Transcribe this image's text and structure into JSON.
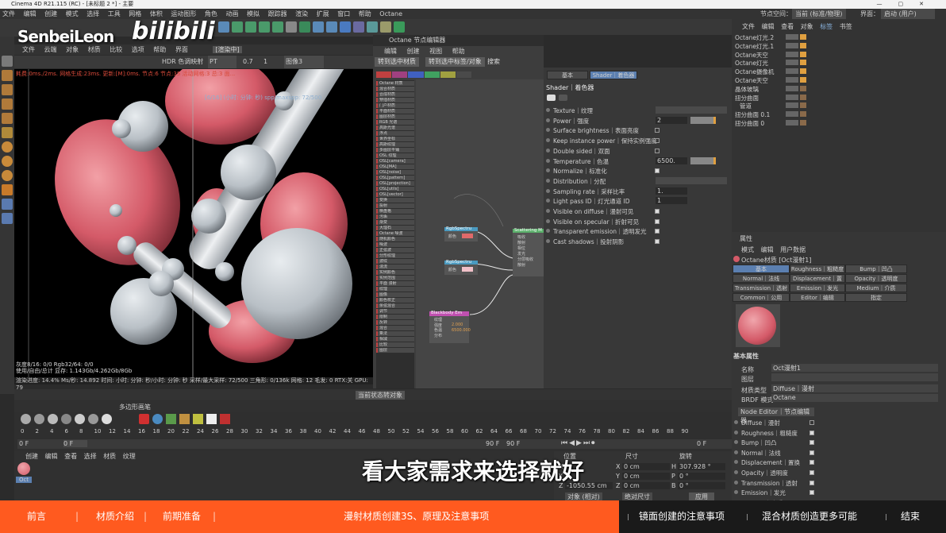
{
  "window": {
    "title": "Cinema 4D R21.115 (RC) - [未标题 2 *] - 主要"
  },
  "menu": [
    "文件",
    "编辑",
    "创建",
    "模式",
    "选择",
    "工具",
    "网格",
    "体积",
    "运动图形",
    "角色",
    "动画",
    "模拟",
    "跟踪器",
    "渲染",
    "扩展",
    "窗口",
    "帮助",
    "Octane"
  ],
  "menu_right": {
    "node_space_label": "节点空间：",
    "node_space_value": "当前 (标准/物理)",
    "layout_label": "界面：",
    "layout_value": "启动 (用户)"
  },
  "watermark": {
    "author": "SenbeiLeon",
    "site": "bilibili"
  },
  "viewport": {
    "menu": [
      "文件",
      "云端",
      "对象",
      "材质",
      "比较",
      "选项",
      "帮助",
      "界面"
    ],
    "title": "[渲染中]",
    "toolbar": {
      "hdr": "HDR 色调映射",
      "pt": "PT",
      "value": "0.7",
      "count": "1",
      "mode": "图像3"
    },
    "status": "耗费:0ms./2ms. 网格生成:23ms. 更新:[M]:0ms. 节点:6 节点:35 活动网格:3 总:3 面...",
    "overlay": "[6/16] (小时: 分钟: 秒) spp/maxspp: 72/500",
    "info1": "灰度8/16: 0/0          Rgb32/64: 0/0",
    "info2": "使用/自由/总计 显存: 1.143Gb/4.262Gb/8Gb",
    "info3": "渲染进度: 14.4%  Ms/秒: 14.892   时间: 小时: 分钟: 秒/小时: 分钟: 秒   采样/最大采样: 72/500   三角形: 0/136k   网格: 12   毛发: 0   RTX:关   GPU: 79"
  },
  "node_editor": {
    "header": "Octane 节点编辑器",
    "menu": [
      "编辑",
      "创建",
      "视图",
      "帮助"
    ],
    "buttons": [
      "转到选中材质",
      "转到选中标签/对象",
      "搜索"
    ],
    "nodes": [
      {
        "name": "RgbSpectru",
        "port": "颜色"
      },
      {
        "name": "RgbSpectru",
        "port": "颜色"
      },
      {
        "name": "Scattering M",
        "ports": [
          "吸收",
          "散射",
          "相位",
          "发光",
          "分层吸收",
          "散射"
        ]
      },
      {
        "name": "Blackbody Em",
        "ports": [
          "纹理",
          "强度",
          "色温",
          "分布"
        ],
        "values": [
          "",
          "2.000",
          "6500.000",
          ""
        ]
      }
    ],
    "palette": [
      "Octane 材质",
      "混合材质",
      "合成材质",
      "穿插材质",
      "门户材质",
      "平面材质",
      "图层材质",
      "RGB 光谱",
      "高斯光谱",
      "浮点",
      "世界坐标",
      "高斯纹理",
      "多图层平铺",
      "OSL 纹理",
      "OSL[camera]",
      "OSL[MA]",
      "OSL[noise]",
      "OSL[pattern]",
      "OSL[projection]",
      "OSL[utils]",
      "OSL[vector]",
      "变换",
      "投射",
      "棋盘格",
      "污垢",
      "渐变",
      "大理石",
      "Octane 噪波",
      "随机颜色",
      "噪波",
      "正弦波",
      "分形纹理",
      "波纹",
      "湍流",
      "实例颜色",
      "实例范围",
      "平面 漫射",
      "纹理",
      "图像",
      "颜色校正",
      "余弦混合",
      "调节",
      "限制",
      "反转",
      "混合",
      "乘法",
      "相减",
      "比较",
      "图层"
    ]
  },
  "shader": {
    "tabs": [
      "基本",
      "Shader｜着色器"
    ],
    "heading": "Shader｜着色器",
    "rows": [
      {
        "label": "Texture｜纹理",
        "type": "link"
      },
      {
        "label": "Power｜强度",
        "value": "2"
      },
      {
        "label": "Surface brightness｜表面亮度",
        "checked": false
      },
      {
        "label": "Keep instance power｜保持实例强度",
        "checked": false
      },
      {
        "label": "Double sided｜双面",
        "checked": false
      },
      {
        "label": "Temperature｜色温",
        "value": "6500."
      },
      {
        "label": "Normalize｜标准化",
        "checked": true
      },
      {
        "label": "Distribution｜分配",
        "type": "link"
      },
      {
        "label": "Sampling rate｜采样比率",
        "value": "1."
      },
      {
        "label": "Light pass ID｜灯光通道 ID",
        "value": "1"
      },
      {
        "label": "Visible on diffuse｜漫射可见",
        "checked": true
      },
      {
        "label": "Visible on specular｜折射可见",
        "checked": true
      },
      {
        "label": "Transparent emission｜透明发光",
        "checked": true
      },
      {
        "label": "Cast shadows｜投射阴影",
        "checked": true
      }
    ]
  },
  "object_manager": {
    "menu": [
      "文件",
      "编辑",
      "查看",
      "对象",
      "标签",
      "书签"
    ],
    "objects": [
      "Octane灯光.2",
      "Octane灯光.1",
      "Octane天空",
      "Octane灯光",
      "Octane摄像机",
      "Octane天空",
      "晶体玻璃",
      "扭分曲面",
      "管道",
      "扭分曲面 0.1",
      "扭分曲面 0"
    ]
  },
  "attr_manager": {
    "header": "属性",
    "menu": [
      "模式",
      "编辑",
      "用户数据"
    ],
    "title": "Octane材质 [Oct漫射1]",
    "tabs": [
      "基本",
      "Roughness｜粗糙度",
      "Bump｜凹凸",
      "Normal｜法线",
      "Displacement｜置换",
      "Opacity｜透明度",
      "Transmission｜透射",
      "Emission｜发光",
      "Medium｜介质",
      "Common｜公用",
      "Editor｜编辑",
      "指定"
    ],
    "section": "基本属性",
    "name_label": "名称",
    "name_value": "Oct漫射1",
    "layer_label": "图层",
    "mat_type_label": "材质类型",
    "mat_type_value": "Diffuse｜漫射",
    "brdf_label": "BRDF 模式",
    "brdf_value": "Octane",
    "node_editor_btn": "Node Editor｜节点编辑器",
    "channels": [
      "Diffuse｜漫射",
      "Roughness｜粗糙度",
      "Bump｜凹凸",
      "Normal｜法线",
      "Displacement｜置换",
      "Opacity｜透明度",
      "Transmission｜透射",
      "Emission｜发光",
      "Medium｜介质"
    ]
  },
  "timeline": {
    "row1": "当前状态转对象",
    "row2": "多边形画笔",
    "ticks": [
      "0",
      "2",
      "4",
      "6",
      "8",
      "10",
      "12",
      "14",
      "16",
      "18",
      "20",
      "22",
      "24",
      "26",
      "28",
      "30",
      "32",
      "34",
      "36",
      "38",
      "40",
      "42",
      "44",
      "46",
      "48",
      "50",
      "52",
      "54",
      "56",
      "58",
      "60",
      "62",
      "64",
      "66",
      "68",
      "70",
      "72",
      "74",
      "76",
      "78",
      "80",
      "82",
      "84",
      "86",
      "88",
      "90"
    ],
    "start": "0 F",
    "current": "0 F",
    "end": "90 F",
    "end2": "90 F",
    "frame_right": "0 F"
  },
  "material_manager": {
    "menu": [
      "创建",
      "编辑",
      "查看",
      "选择",
      "材质",
      "纹理"
    ],
    "material": "Oct"
  },
  "coordinates": {
    "headers": [
      "位置",
      "尺寸",
      "旋转"
    ],
    "rows": [
      {
        "axis": "X",
        "pos": "",
        "size": "0 cm",
        "rot_axis": "H",
        "rot": "307.928 °"
      },
      {
        "axis": "Y",
        "pos": "",
        "size": "0 cm",
        "rot_axis": "P",
        "rot": "0 °"
      },
      {
        "axis": "Z",
        "pos": "-1050.55 cm",
        "size": "0 cm",
        "rot_axis": "B",
        "rot": "0 °"
      }
    ],
    "mode1": "对象 (相对)",
    "mode2": "绝对尺寸",
    "apply": "应用"
  },
  "subtitle": "看大家需求来选择就好",
  "chapters": [
    "前言",
    "材质介绍",
    "前期准备",
    "漫射材质创建3S、原理及注意事项",
    "镜面创建的注意事项",
    "混合材质创造更多可能",
    "结束"
  ],
  "colors": {
    "chapter_bar": "#ff5a1f",
    "chapter_dark": "#1a1a1a",
    "accent": "#5b7fb0",
    "render_pink": "#d45a68",
    "render_gray": "#c7cdd2"
  }
}
